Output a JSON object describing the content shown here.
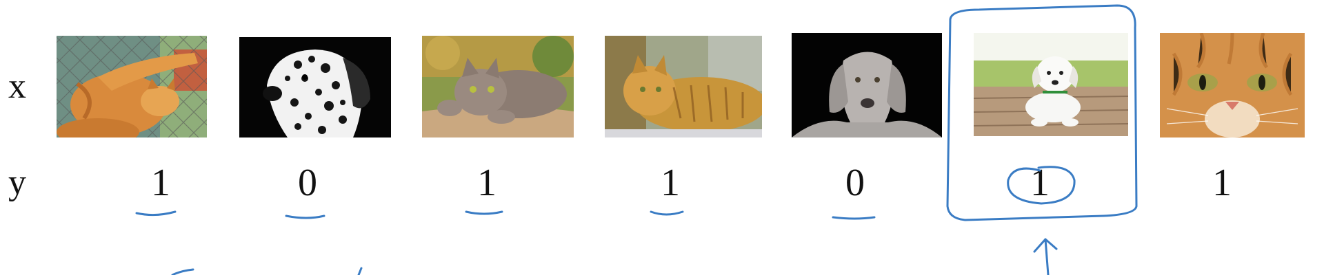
{
  "rows": {
    "x_label": "x",
    "y_label": "y"
  },
  "examples": [
    {
      "animal": "cat",
      "y": "1",
      "underlined": true
    },
    {
      "animal": "dog",
      "y": "0",
      "underlined": true
    },
    {
      "animal": "cat",
      "y": "1",
      "underlined": true
    },
    {
      "animal": "cat",
      "y": "1",
      "underlined": true
    },
    {
      "animal": "dog",
      "y": "0",
      "underlined": true
    },
    {
      "animal": "dog",
      "y": "1",
      "boxed": true,
      "circled": true
    },
    {
      "animal": "cat",
      "y": "1",
      "underlined": false
    }
  ],
  "colors": {
    "ink": "#3a7cc4",
    "text": "#111111"
  }
}
